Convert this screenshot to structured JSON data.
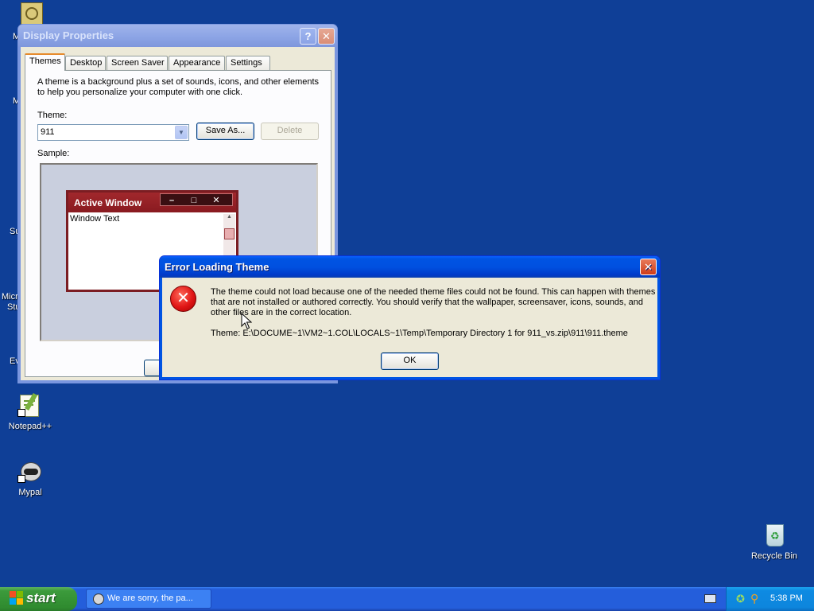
{
  "desktop": {
    "icons": [
      {
        "label": "Notepad++"
      },
      {
        "label": "Mypal"
      },
      {
        "label": "Recycle Bin"
      }
    ],
    "partial_labels": [
      "M",
      "M",
      "Su",
      "Micro",
      "Stu",
      "Ev"
    ]
  },
  "display_properties": {
    "title": "Display Properties",
    "tabs": [
      "Themes",
      "Desktop",
      "Screen Saver",
      "Appearance",
      "Settings"
    ],
    "description_line1": "A theme is a background plus a set of sounds, icons, and other elements",
    "description_line2": "to help you personalize your computer with one click.",
    "theme_label": "Theme:",
    "theme_value": "911",
    "save_as_label": "Save As...",
    "delete_label": "Delete",
    "sample_label": "Sample:",
    "sample_window_title": "Active Window",
    "sample_window_text": "Window Text"
  },
  "error_dialog": {
    "title": "Error Loading Theme",
    "message_line1": "The theme could not load because one of the needed theme files could not be found.  This can happen with themes",
    "message_line2": "that are not installed or authored correctly.  You should verify that the wallpaper, screensaver, icons, sounds, and",
    "message_line3": "other files are in the correct location.",
    "theme_path": "Theme: E:\\DOCUME~1\\VM2~1.COL\\LOCALS~1\\Temp\\Temporary Directory 1 for 911_vs.zip\\911\\911.theme",
    "ok_label": "OK"
  },
  "taskbar": {
    "start_label": "start",
    "task_item_label": "We are sorry, the pa...",
    "clock": "5:38 PM"
  },
  "colors": {
    "desktop_background": "#0f3f97",
    "titlebar_active": "#0054e3",
    "start_green": "#3c9b3c",
    "error_red": "#e01616"
  }
}
